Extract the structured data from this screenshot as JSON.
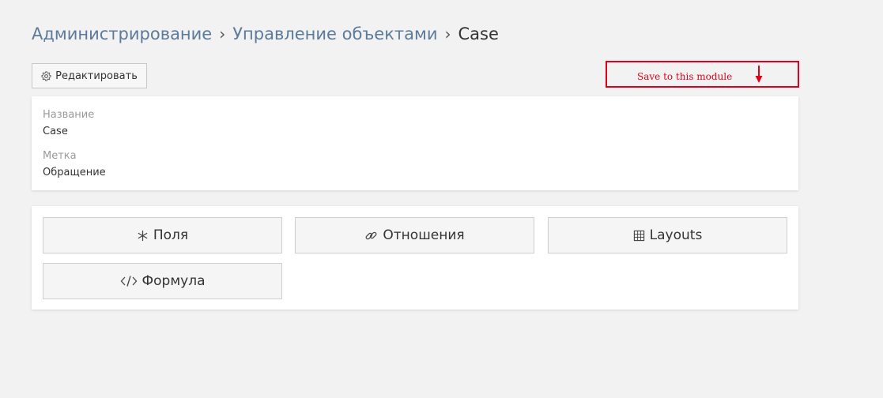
{
  "breadcrumb": {
    "items": [
      "Администрирование",
      "Управление объектами"
    ],
    "separator": "›",
    "current": "Case"
  },
  "toolbar": {
    "edit_label": "Редактировать",
    "edit_icon": "gear-icon"
  },
  "annotation": {
    "text": "Save to this module",
    "color": "#e0001b"
  },
  "details": {
    "fields": [
      {
        "label": "Название",
        "value": "Case"
      },
      {
        "label": "Метка",
        "value": "Обращение"
      }
    ]
  },
  "actions": {
    "buttons": [
      {
        "label": "Поля",
        "icon": "asterisk-icon"
      },
      {
        "label": "Отношения",
        "icon": "link-icon"
      },
      {
        "label": "Layouts",
        "icon": "grid-icon"
      },
      {
        "label": "Формула",
        "icon": "code-icon"
      }
    ]
  },
  "colors": {
    "background": "#f2f2f2",
    "link": "#5c7a99",
    "annotation": "#e0001b"
  }
}
